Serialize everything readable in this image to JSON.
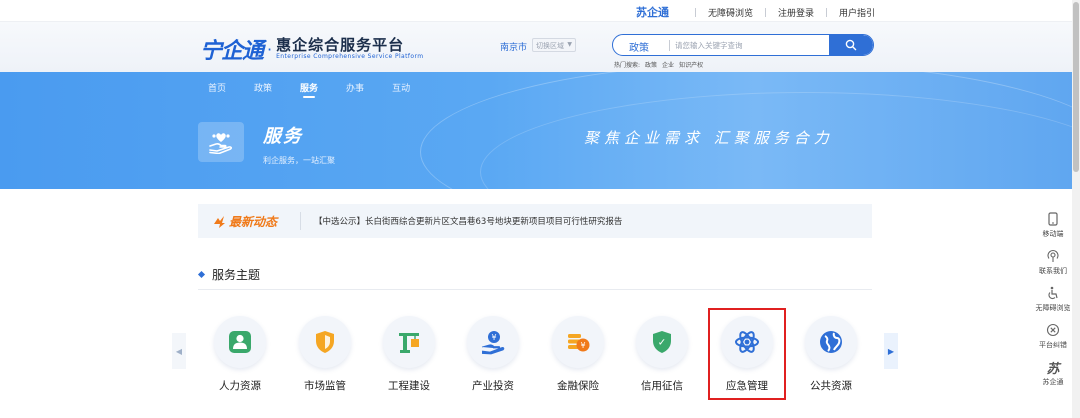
{
  "topbar": {
    "brand": "苏企通",
    "links": [
      "无障碍浏览",
      "注册登录",
      "用户指引"
    ]
  },
  "header": {
    "logo_mark": "宁企通",
    "logo_dot": "·",
    "logo_cn": "惠企综合服务平台",
    "logo_en": "Enterprise Comprehensive Service Platform",
    "city": "南京市",
    "district_placeholder": "切换区域",
    "search": {
      "category": "政策",
      "placeholder": "请您输入关键字查询",
      "hot_label": "热门搜索:",
      "hot_terms": [
        "政策",
        "企业",
        "知识产权"
      ]
    }
  },
  "nav": {
    "items": [
      {
        "label": "首页",
        "active": false
      },
      {
        "label": "政策",
        "active": false
      },
      {
        "label": "服务",
        "active": true
      },
      {
        "label": "办事",
        "active": false
      },
      {
        "label": "互动",
        "active": false
      }
    ]
  },
  "banner": {
    "title": "服务",
    "subtitle": "利企服务，一站汇聚",
    "slogan": "聚焦企业需求 汇聚服务合力"
  },
  "news": {
    "label": "最新动态",
    "text": "【中选公示】长白街西综合更新片区文昌巷63号地块更新项目项目可行性研究报告"
  },
  "section": {
    "title": "服务主题"
  },
  "themes": [
    {
      "name": "人力资源",
      "icon": "person-icon",
      "color": "#3aa86b"
    },
    {
      "name": "市场监管",
      "icon": "shield-icon",
      "color": "#f5a623"
    },
    {
      "name": "工程建设",
      "icon": "crane-icon",
      "color": "#3aa86b"
    },
    {
      "name": "产业投资",
      "icon": "investment-icon",
      "color": "#2f6fd6"
    },
    {
      "name": "金融保险",
      "icon": "coins-icon",
      "color": "#f5a623"
    },
    {
      "name": "信用征信",
      "icon": "credit-shield-icon",
      "color": "#3aa86b"
    },
    {
      "name": "应急管理",
      "icon": "atom-icon",
      "color": "#2f6fd6",
      "selected": true
    },
    {
      "name": "公共资源",
      "icon": "globe-icon",
      "color": "#2f6fd6"
    }
  ],
  "float_toolbar": [
    {
      "label": "移动端",
      "icon": "mobile-icon"
    },
    {
      "label": "联系我们",
      "icon": "contact-icon"
    },
    {
      "label": "无障碍浏览",
      "icon": "accessibility-icon"
    },
    {
      "label": "平台纠错",
      "icon": "error-report-icon"
    },
    {
      "label": "苏企通",
      "icon": "su-logo-icon"
    }
  ],
  "colors": {
    "primary": "#2f6fd6",
    "banner": "#4a9bf0",
    "accent_orange": "#f07a1a",
    "highlight_red": "#e02020"
  }
}
